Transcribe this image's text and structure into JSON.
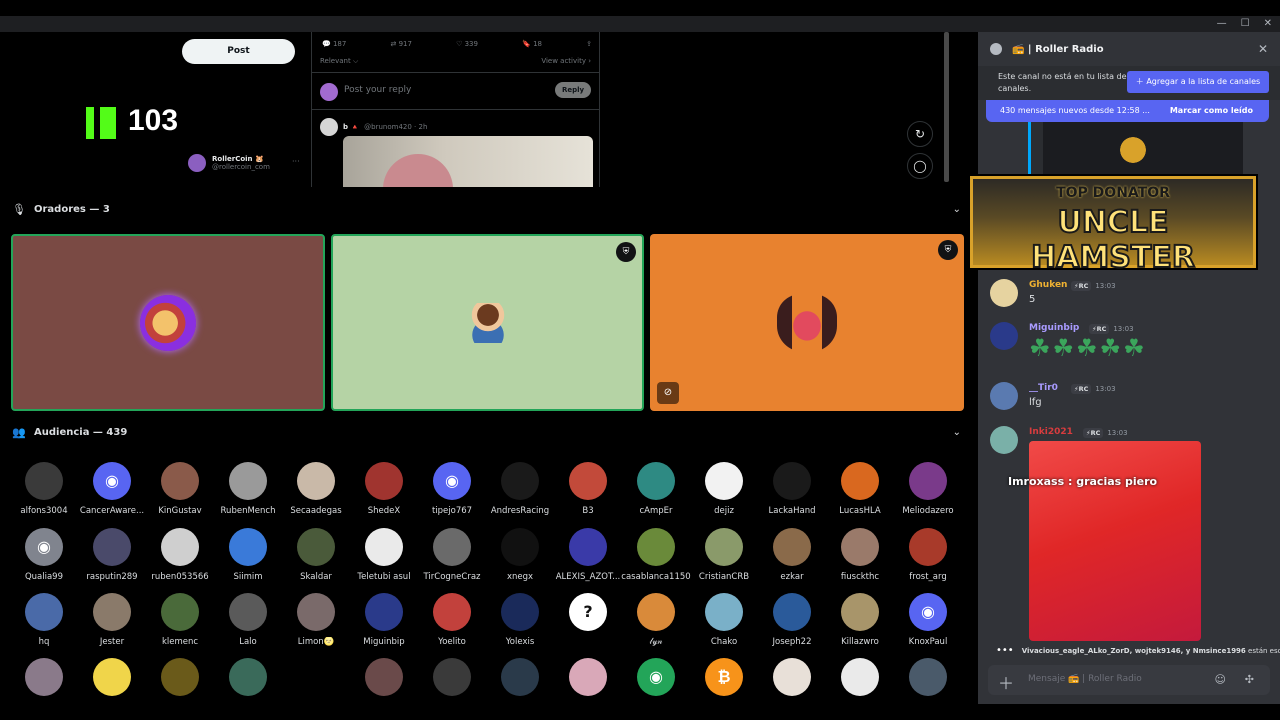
{
  "stream": {
    "post_label": "Post",
    "kick_count": "103",
    "rc_name": "RollerCoin 🐹",
    "rc_handle": "@rollercoin_com",
    "rc_more": "···",
    "tweet_stats": [
      "187",
      "917",
      "339",
      "18"
    ],
    "relevant": "Relevant ⌵",
    "view_activity": "View activity ›",
    "reply_placeholder": "Post your reply",
    "reply_button": "Reply",
    "b_name": "b 🔺",
    "b_handle": "@brunom420 · 2h"
  },
  "speakers": {
    "label": "Oradores — 3"
  },
  "audience": {
    "label": "Audiencia — 439",
    "rows": [
      [
        {
          "name": "alfons3004",
          "color": "#3a3a3a",
          "glyph": ""
        },
        {
          "name": "CancerAware...",
          "color": "#5865f2",
          "glyph": "◉"
        },
        {
          "name": "KinGustav",
          "color": "#8a5a4a",
          "glyph": ""
        },
        {
          "name": "RubenMench",
          "color": "#9a9a9a",
          "glyph": ""
        },
        {
          "name": "Secaadegas",
          "color": "#c9b9a8",
          "glyph": ""
        },
        {
          "name": "ShedeX",
          "color": "#a0342f",
          "glyph": ""
        },
        {
          "name": "tipejo767",
          "color": "#5865f2",
          "glyph": "◉"
        },
        {
          "name": "AndresRacing",
          "color": "#1a1a1a",
          "glyph": ""
        },
        {
          "name": "B3",
          "color": "#c24a3a",
          "glyph": ""
        },
        {
          "name": "cAmpEr",
          "color": "#2e8a83",
          "glyph": ""
        },
        {
          "name": "dejiz",
          "color": "#f2f2f2",
          "glyph": ""
        },
        {
          "name": "LackaHand",
          "color": "#1a1a1a",
          "glyph": ""
        },
        {
          "name": "LucasHLA",
          "color": "#d9681f",
          "glyph": ""
        },
        {
          "name": "Meliodazero",
          "color": "#7a3a8a",
          "glyph": ""
        }
      ],
      [
        {
          "name": "Qualia99",
          "color": "#80848e",
          "glyph": "◉"
        },
        {
          "name": "rasputin289",
          "color": "#4a4a6a",
          "glyph": ""
        },
        {
          "name": "ruben053566",
          "color": "#cfcfcf",
          "glyph": ""
        },
        {
          "name": "Siimim",
          "color": "#3a7ad9",
          "glyph": ""
        },
        {
          "name": "Skaldar",
          "color": "#4a5a3a",
          "glyph": ""
        },
        {
          "name": "Teletubi asul",
          "color": "#eaeaea",
          "glyph": ""
        },
        {
          "name": "TirCogneCraz",
          "color": "#6a6a6a",
          "glyph": ""
        },
        {
          "name": "xnegx",
          "color": "#111111",
          "glyph": ""
        },
        {
          "name": "ALEXIS_AZOT...",
          "color": "#3a3aa8",
          "glyph": ""
        },
        {
          "name": "casablanca1150",
          "color": "#6a8a3a",
          "glyph": ""
        },
        {
          "name": "CristianCRB",
          "color": "#8a9a6a",
          "glyph": ""
        },
        {
          "name": "ezkar",
          "color": "#8a6a4a",
          "glyph": ""
        },
        {
          "name": "fiusckthc",
          "color": "#9a7a6a",
          "glyph": ""
        },
        {
          "name": "frost_arg",
          "color": "#a83a2a",
          "glyph": ""
        }
      ],
      [
        {
          "name": "hq",
          "color": "#4a6aa8",
          "glyph": ""
        },
        {
          "name": "Jester",
          "color": "#8a7a6a",
          "glyph": ""
        },
        {
          "name": "klemenc",
          "color": "#4a6a3a",
          "glyph": ""
        },
        {
          "name": "Lalo",
          "color": "#5a5a5a",
          "glyph": ""
        },
        {
          "name": "Limon🌝",
          "color": "#7a6a6a",
          "glyph": ""
        },
        {
          "name": "Miguinbip",
          "color": "#2a3a8a",
          "glyph": ""
        },
        {
          "name": "Yoelito",
          "color": "#c2413c",
          "glyph": ""
        },
        {
          "name": "Yolexis",
          "color": "#1a2a5a",
          "glyph": ""
        },
        {
          "name": "ﾠﾠﾠﾠﾠﾠﾠﾠ",
          "color": "#ffffff",
          "glyph": "?"
        },
        {
          "name": "𝓁𝓎𝓃",
          "color": "#d98a3a",
          "glyph": ""
        },
        {
          "name": "Chako",
          "color": "#7ab0c8",
          "glyph": ""
        },
        {
          "name": "Joseph22",
          "color": "#2a5a9a",
          "glyph": ""
        },
        {
          "name": "Killazwro",
          "color": "#a8956a",
          "glyph": ""
        },
        {
          "name": "KnoxPaul",
          "color": "#5865f2",
          "glyph": "◉"
        }
      ],
      [
        {
          "name": "",
          "color": "#8a7a8a",
          "glyph": ""
        },
        {
          "name": "",
          "color": "#f0d54a",
          "glyph": ""
        },
        {
          "name": "",
          "color": "#6a5a1a",
          "glyph": ""
        },
        {
          "name": "",
          "color": "#3a6a5a",
          "glyph": ""
        },
        {
          "name": "",
          "color": "#000000",
          "glyph": ""
        },
        {
          "name": "",
          "color": "#6a4a4a",
          "glyph": ""
        },
        {
          "name": "",
          "color": "#3a3a3a",
          "glyph": ""
        },
        {
          "name": "",
          "color": "#2a3a4a",
          "glyph": ""
        },
        {
          "name": "",
          "color": "#d9a8b8",
          "glyph": ""
        },
        {
          "name": "",
          "color": "#23a559",
          "glyph": "◉"
        },
        {
          "name": "",
          "color": "#f7931a",
          "glyph": "₿"
        },
        {
          "name": "",
          "color": "#e8e0d8",
          "glyph": ""
        },
        {
          "name": "",
          "color": "#eaeaea",
          "glyph": ""
        },
        {
          "name": "",
          "color": "#4a5a6a",
          "glyph": ""
        }
      ]
    ]
  },
  "panel": {
    "title": "📻 | Roller Radio",
    "notice_text": "Este canal no está en tu lista de canales.",
    "add_button": "＋ Agregar a la lista de canales",
    "new_messages": "430 mensajes nuevos desde 12:58 ...",
    "mark_read": "Marcar como leído",
    "banner_top": "TOP DONATOR",
    "banner_main": "UNCLE HAMSTER",
    "messages": [
      {
        "name": "Ghuken",
        "color": "#f0b232",
        "tag": "⚡RC",
        "time": "13:03",
        "text": "5",
        "avatar": "#e6d3a0"
      },
      {
        "name": "Miguinbip",
        "color": "#a99bff",
        "tag": "⚡RC",
        "time": "13:03",
        "text": "",
        "avatar": "#2a3a8a"
      },
      {
        "name": "__Tir0",
        "color": "#a99bff",
        "tag": "⚡RC",
        "time": "13:03",
        "text": "lfg",
        "avatar": "#5a7ab0"
      },
      {
        "name": "Inki2021",
        "color": "#d83c3e",
        "tag": "⚡RC",
        "time": "13:03",
        "text": "",
        "avatar": "#7ab0a8"
      }
    ],
    "clovers": "☘☘☘☘☘",
    "overlay_text": "Imroxass : gracias piero",
    "typing_names": "Vivacious_eagle_ALko_ZorD, wojtek9146, y Nmsince1996",
    "typing_suffix": " están escrib...",
    "compose_placeholder": "Mensaje 📻 | Roller Radio"
  },
  "colors": {
    "discord_blurple": "#5865f2",
    "speaking_green": "#23a559",
    "panel_bg": "#313338"
  }
}
